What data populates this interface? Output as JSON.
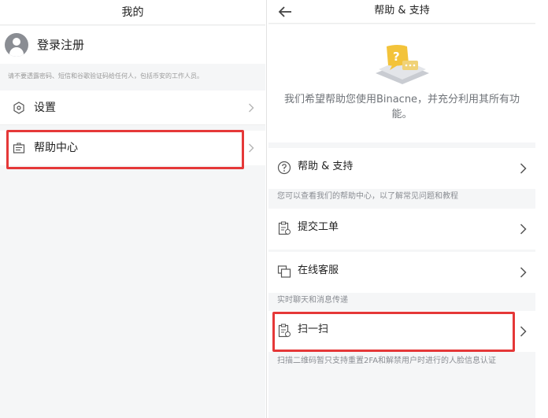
{
  "left": {
    "title": "我的",
    "login_label": "登录注册",
    "notice": "请不要透露密码、短信和谷歌验证码给任何人，包括币安的工作人员。",
    "menu": [
      {
        "label": "设置",
        "icon": "settings-hex-icon"
      },
      {
        "label": "帮助中心",
        "icon": "help-center-icon"
      }
    ]
  },
  "right": {
    "title": "帮助 & 支持",
    "hero_text": "我们希望帮助您使用Binacne，并充分利用其所有功能。",
    "rows": [
      {
        "label": "帮助 & 支持",
        "icon": "question-circle-icon",
        "caption": "您可以查看我们的帮助中心，以了解常见问题和教程"
      },
      {
        "label": "提交工单",
        "icon": "ticket-icon"
      },
      {
        "label": "在线客服",
        "icon": "chat-icon",
        "caption": "实时聊天和消息传递"
      },
      {
        "label": "扫一扫",
        "icon": "scan-icon",
        "caption": "扫描二维码暂只支持重置2FA和解禁用户时进行的人脸信息认证"
      }
    ]
  },
  "colors": {
    "highlight_red": "#e53838",
    "accent_yellow": "#f3c33a",
    "background": "#f5f6f7"
  }
}
